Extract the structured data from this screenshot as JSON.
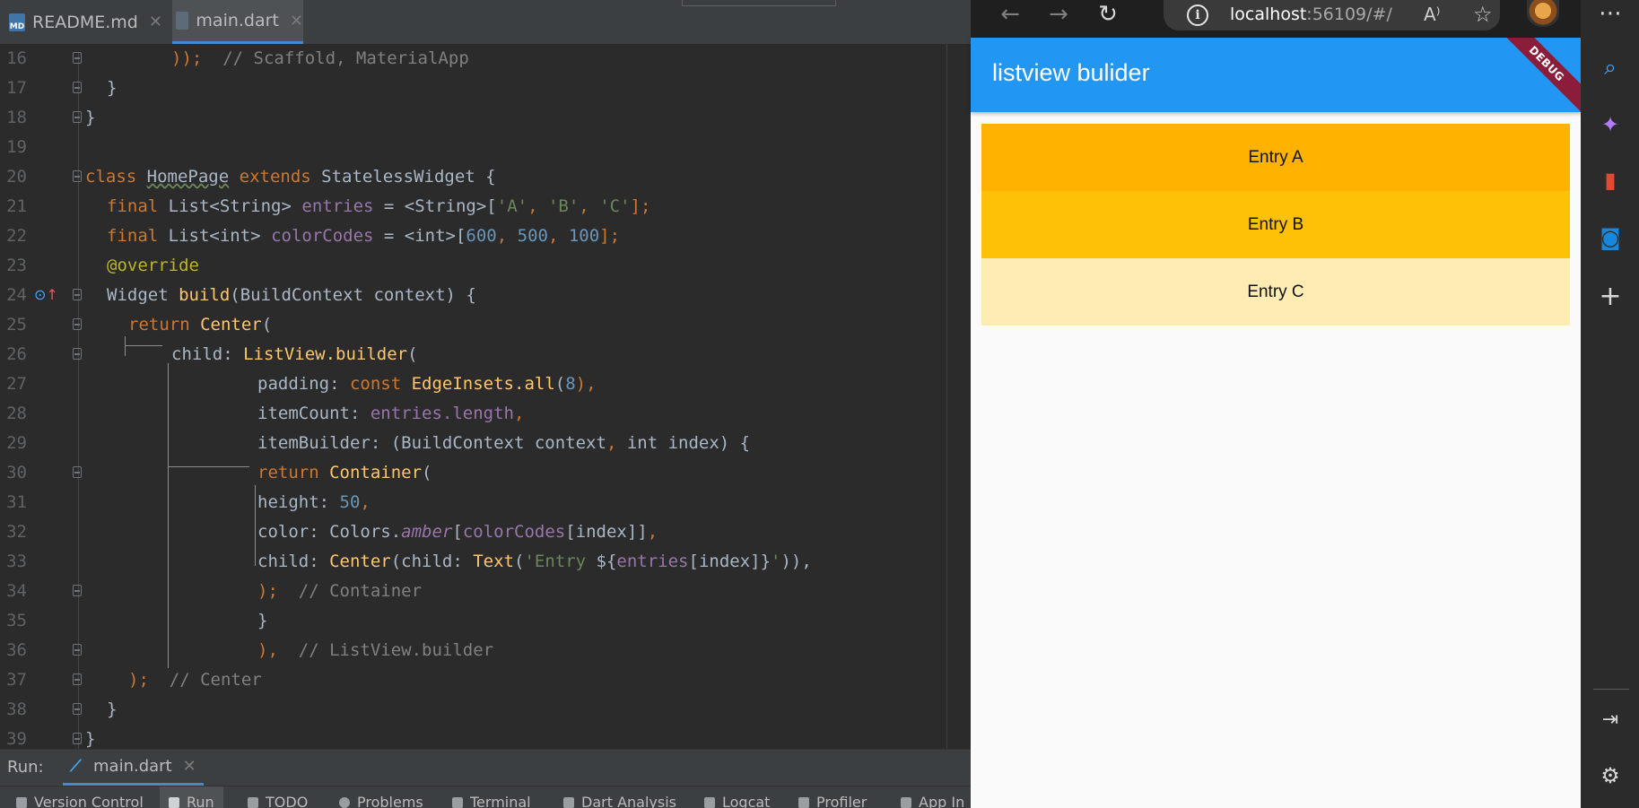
{
  "ide": {
    "tabs": [
      {
        "label": "README.md",
        "icon": "markdown-file-icon"
      },
      {
        "label": "main.dart",
        "icon": "dart-file-icon"
      }
    ],
    "code_lines": [
      {
        "num": "16"
      },
      {
        "num": "17"
      },
      {
        "num": "18"
      },
      {
        "num": "19"
      },
      {
        "num": "20"
      },
      {
        "num": "21"
      },
      {
        "num": "22"
      },
      {
        "num": "23"
      },
      {
        "num": "24"
      },
      {
        "num": "25"
      },
      {
        "num": "26"
      },
      {
        "num": "27"
      },
      {
        "num": "28"
      },
      {
        "num": "29"
      },
      {
        "num": "30"
      },
      {
        "num": "31"
      },
      {
        "num": "32"
      },
      {
        "num": "33"
      },
      {
        "num": "34"
      },
      {
        "num": "35"
      },
      {
        "num": "36"
      },
      {
        "num": "37"
      },
      {
        "num": "38"
      },
      {
        "num": "39"
      }
    ],
    "code": {
      "l16": {
        "a": "));",
        "b": "// Scaffold, MaterialApp"
      },
      "l17": "}",
      "l18": "}",
      "l20": {
        "kw": "class",
        "name": "HomePage",
        "ext": "extends",
        "base": "StatelessWidget {"
      },
      "l21": {
        "kw": "final",
        "type": "List<String>",
        "field": "entries",
        "eq": " = <String>[",
        "s1": "'A'",
        "s2": "'B'",
        "s3": "'C'",
        "end": "];"
      },
      "l22": {
        "kw": "final",
        "type": "List<int>",
        "field": "colorCodes",
        "eq": " = <int>[",
        "n1": "600",
        "n2": "500",
        "n3": "100",
        "end": "];"
      },
      "l23": {
        "at": "@",
        "name": "override"
      },
      "l24": {
        "type": "Widget",
        "fn": "build",
        "rest": "(BuildContext context) {"
      },
      "l25": {
        "kw": "return",
        "fn": "Center",
        "rest": "("
      },
      "l26": {
        "a": "child: ",
        "fn": "ListView.builder",
        "rest": "("
      },
      "l27": {
        "a": "padding: ",
        "kw": "const",
        "cls": "EdgeInsets",
        "fn": ".all",
        "p1": "(",
        "n": "8",
        "p2": "),"
      },
      "l28": {
        "a": "itemCount: ",
        "field": "entries.length",
        "end": ","
      },
      "l29": {
        "a": "itemBuilder: (BuildContext context",
        "c": ",",
        "b": " int index) {"
      },
      "l30": {
        "kw": "return",
        "fn": "Container",
        "rest": "("
      },
      "l31": {
        "a": "height: ",
        "n": "50",
        "end": ","
      },
      "l32": {
        "a": "color: Colors.",
        "it": "amber",
        "b": "[",
        "field": "colorCodes",
        "c": "[index]]",
        "end": ","
      },
      "l33": {
        "a": "child: ",
        "fn1": "Center",
        "b": "(child: ",
        "fn2": "Text",
        "c": "(",
        "s1": "'Entry ",
        "d": "${",
        "field": "entries",
        "e": "[index]}",
        "s2": "'",
        "f": ")),"
      },
      "l34": {
        "a": ");",
        "b": "// Container"
      },
      "l35": "}",
      "l36": {
        "a": "),",
        "b": "// ListView.builder"
      },
      "l37": {
        "a": ");",
        "b": "// Center"
      },
      "l38": "}",
      "l39": "}"
    },
    "run_label": "Run:",
    "run_tab": "main.dart",
    "tool_windows": [
      "Version Control",
      "Run",
      "TODO",
      "Problems",
      "Terminal",
      "Dart Analysis",
      "Logcat",
      "Profiler",
      "App In"
    ]
  },
  "browser": {
    "url_host": "localhost",
    "url_rest": ":56109/#/",
    "app_title": "listview bulider",
    "debug_label": "DEBUG",
    "entries": [
      "Entry A",
      "Entry B",
      "Entry C"
    ],
    "entry_colors": [
      "#ffb300",
      "#ffc107",
      "#ffecb3"
    ],
    "app_bar_color": "#2196f3"
  }
}
